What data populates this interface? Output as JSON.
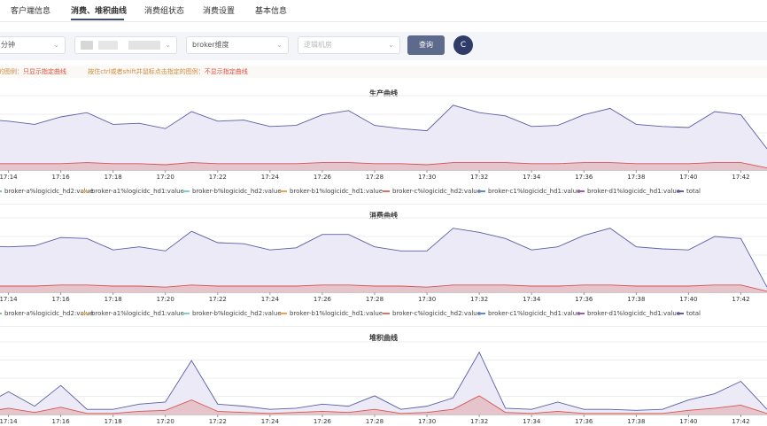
{
  "tabs": [
    "客户端信息",
    "消费、堆积曲线",
    "消费组状态",
    "消费设置",
    "基本信息"
  ],
  "toolbar": {
    "time_select": "分钟",
    "broker_select": "broker维度",
    "logic_select_placeholder": "逻辑机房",
    "query_label": "查询",
    "refresh_icon": "C"
  },
  "hints": {
    "prefix1": "的图例：",
    "red1": "只显示指定曲线",
    "prefix2": "按住ctrl或者shift并鼠标点击指定的图例：",
    "red2": "不显示指定曲线"
  },
  "colors": {
    "total": "#5b5ea6",
    "fill": "#ebeaf6",
    "red": "#d9534f",
    "accent": "#3d4a7a"
  },
  "legend": [
    {
      "label": "broker-a%logicidc_hd2:value",
      "color": "#8fbc8f"
    },
    {
      "label": "broker-a1%logicidc_hd1:value",
      "color": "#e6b86a"
    },
    {
      "label": "broker-b%logicidc_hd2:value",
      "color": "#7fd1c7"
    },
    {
      "label": "broker-b1%logicidc_hd1:value",
      "color": "#f0a050"
    },
    {
      "label": "broker-c%logicidc_hd2:value",
      "color": "#e07060"
    },
    {
      "label": "broker-c1%logicidc_hd1:value",
      "color": "#5d8ad8"
    },
    {
      "label": "broker-d1%logicidc_hd1:value",
      "color": "#9b59b6"
    },
    {
      "label": "total",
      "color": "#5b5ea6"
    }
  ],
  "x_ticks": [
    "17:14",
    "17:16",
    "17:18",
    "17:20",
    "17:22",
    "17:24",
    "17:26",
    "17:28",
    "17:30",
    "17:32",
    "17:34",
    "17:36",
    "17:38",
    "17:40",
    "17:42"
  ],
  "chart_data": [
    {
      "type": "area",
      "title": "生产曲线",
      "x": [
        "17:13",
        "17:14",
        "17:15",
        "17:16",
        "17:17",
        "17:18",
        "17:19",
        "17:20",
        "17:21",
        "17:22",
        "17:23",
        "17:24",
        "17:25",
        "17:26",
        "17:27",
        "17:28",
        "17:29",
        "17:30",
        "17:31",
        "17:32",
        "17:33",
        "17:34",
        "17:35",
        "17:36",
        "17:37",
        "17:38",
        "17:39",
        "17:40",
        "17:41",
        "17:42",
        "17:43"
      ],
      "series": [
        {
          "name": "total",
          "values": [
            48,
            46,
            43,
            50,
            54,
            43,
            44,
            39,
            55,
            46,
            47,
            41,
            42,
            52,
            56,
            42,
            39,
            37,
            61,
            54,
            51,
            41,
            42,
            52,
            58,
            43,
            41,
            40,
            55,
            52,
            20
          ]
        },
        {
          "name": "broker-c%logicidc_hd2:value",
          "values": [
            6,
            6,
            6,
            6,
            7,
            6,
            6,
            5,
            7,
            6,
            6,
            6,
            6,
            7,
            7,
            6,
            6,
            5,
            7,
            7,
            7,
            6,
            6,
            7,
            7,
            6,
            6,
            6,
            7,
            7,
            2
          ]
        }
      ]
    },
    {
      "type": "area",
      "title": "消费曲线",
      "x": [
        "17:13",
        "17:14",
        "17:15",
        "17:16",
        "17:17",
        "17:18",
        "17:19",
        "17:20",
        "17:21",
        "17:22",
        "17:23",
        "17:24",
        "17:25",
        "17:26",
        "17:27",
        "17:28",
        "17:29",
        "17:30",
        "17:31",
        "17:32",
        "17:33",
        "17:34",
        "17:35",
        "17:36",
        "17:37",
        "17:38",
        "17:39",
        "17:40",
        "17:41",
        "17:42",
        "17:43"
      ],
      "series": [
        {
          "name": "total",
          "values": [
            45,
            44,
            45,
            53,
            52,
            41,
            44,
            40,
            59,
            48,
            47,
            41,
            43,
            56,
            56,
            44,
            40,
            40,
            62,
            58,
            52,
            41,
            44,
            55,
            62,
            44,
            42,
            41,
            54,
            52,
            5
          ]
        },
        {
          "name": "broker-c%logicidc_hd2:value",
          "values": [
            6,
            6,
            6,
            7,
            7,
            6,
            6,
            5,
            7,
            6,
            6,
            6,
            6,
            7,
            7,
            6,
            6,
            5,
            7,
            7,
            7,
            6,
            6,
            7,
            7,
            6,
            6,
            6,
            7,
            7,
            1
          ]
        }
      ]
    },
    {
      "type": "area",
      "title": "堆积曲线",
      "x": [
        "17:13",
        "17:14",
        "17:15",
        "17:16",
        "17:17",
        "17:18",
        "17:19",
        "17:20",
        "17:21",
        "17:22",
        "17:23",
        "17:24",
        "17:25",
        "17:26",
        "17:27",
        "17:28",
        "17:29",
        "17:30",
        "17:31",
        "17:32",
        "17:33",
        "17:34",
        "17:35",
        "17:36",
        "17:37",
        "17:38",
        "17:39",
        "17:40",
        "17:41",
        "17:42",
        "17:43"
      ],
      "series": [
        {
          "name": "total",
          "values": [
            8,
            22,
            8,
            28,
            5,
            5,
            10,
            12,
            52,
            10,
            8,
            5,
            6,
            10,
            8,
            18,
            5,
            8,
            16,
            60,
            6,
            5,
            12,
            5,
            5,
            4,
            5,
            14,
            20,
            32,
            5
          ]
        },
        {
          "name": "broker-c%logicidc_hd2:value",
          "values": [
            2,
            6,
            2,
            7,
            1,
            1,
            3,
            4,
            14,
            3,
            2,
            1,
            2,
            3,
            2,
            5,
            1,
            2,
            5,
            18,
            2,
            1,
            3,
            1,
            1,
            1,
            1,
            4,
            6,
            9,
            1
          ]
        }
      ]
    }
  ]
}
